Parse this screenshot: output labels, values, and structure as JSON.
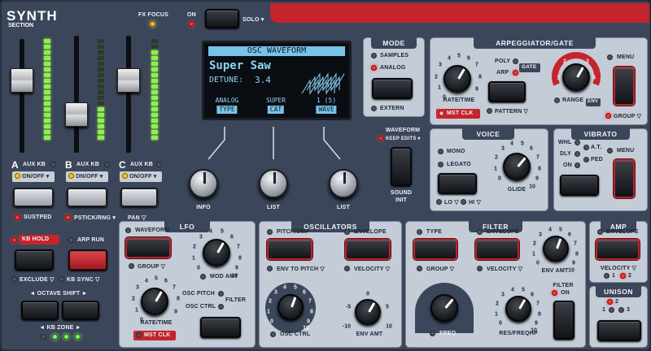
{
  "header": {
    "title": "SYNTH",
    "subtitle": "SECTION",
    "fx_focus": "FX FOCUS",
    "on": "ON",
    "solo": "SOLO ▾"
  },
  "lcd": {
    "title": "OSC WAVEFORM",
    "patch": "Super Saw",
    "param": "DETUNE:",
    "param_value": "3.4",
    "soft": [
      {
        "top": "ANALOG",
        "chip": "TYPE"
      },
      {
        "top": "SUPER",
        "chip": "CAT"
      },
      {
        "top": "1 (5)",
        "chip": "WAVE"
      }
    ]
  },
  "lcd_knobs": [
    "INFO",
    "LIST",
    "LIST"
  ],
  "mode": {
    "title": "MODE",
    "samples": "SAMPLES",
    "analog": "ANALOG",
    "extern": "EXTERN"
  },
  "waveform": {
    "label": "WAVEFORM",
    "keep": "KEEP EDITS ▾",
    "sound_init_1": "SOUND",
    "sound_init_2": "INIT"
  },
  "arp": {
    "title": "ARPEGGIATOR/GATE",
    "rate_time": "RATE/TIME",
    "mst_clk": "MST CLK",
    "poly": "POLY",
    "gate": "GATE",
    "arp": "ARP",
    "pattern": "PATTERN ▽",
    "range": "RANGE",
    "env": "ENV",
    "menu": "MENU",
    "group": "GROUP ▽",
    "rate_ticks": [
      "1",
      "2",
      "3",
      "4",
      "5",
      "6",
      "7",
      "8",
      "0",
      "9"
    ],
    "range_ticks": [
      "1",
      "2",
      "3",
      "4"
    ]
  },
  "voice": {
    "title": "VOICE",
    "mono": "MONO",
    "legato": "LEGATO",
    "glide": "GLIDE",
    "lo": "LO ▽",
    "hi": "HI ▽",
    "ticks": [
      "0",
      "1",
      "2",
      "3",
      "4",
      "5",
      "6",
      "7",
      "8",
      "9",
      "10"
    ]
  },
  "vibrato": {
    "title": "VIBRATO",
    "whl": "WHL",
    "at": "A.T.",
    "dly": "DLY",
    "ped": "PED",
    "on": "ON",
    "menu": "MENU"
  },
  "layers": [
    {
      "letter": "A",
      "aux": "AUX KB",
      "onoff": "ON/OFF ▾"
    },
    {
      "letter": "B",
      "aux": "AUX KB",
      "onoff": "ON/OFF ▾"
    },
    {
      "letter": "C",
      "aux": "AUX KB",
      "onoff": "ON/OFF ▾"
    }
  ],
  "layer_bottom": {
    "sustped": "SUSTPED",
    "pstick": "PSTICK/RNG ▾",
    "pan": "PAN ▽"
  },
  "kb": {
    "hold": "KB HOLD",
    "arp_run": "ARP RUN",
    "exclude": "EXCLUDE ▽",
    "kb_sync": "KB SYNC ▽",
    "octave_shift": "◄ OCTAVE SHIFT ►",
    "kb_zone": "◄ KB ZONE ►"
  },
  "lfo": {
    "title": "LFO",
    "waveform": "WAVEFORM",
    "group": "GROUP ▽",
    "mod_amt": "MOD AMT",
    "rate_time": "RATE/TIME",
    "mst_clk": "MST CLK",
    "osc_pitch": "OSC PITCH",
    "osc_ctrl": "OSC CTRL",
    "filter": "FILTER",
    "mod_ticks": [
      "0",
      "1",
      "2",
      "3",
      "4",
      "5",
      "6",
      "7",
      "8",
      "9",
      "10"
    ],
    "rate_ticks": [
      "1",
      "2",
      "3",
      "4",
      "5",
      "6",
      "7",
      "8",
      "0",
      "9"
    ]
  },
  "oscillators": {
    "title": "OSCILLATORS",
    "pitch_smp": "PITCH/SMP",
    "env_to_pitch": "ENV TO PITCH ▽",
    "envelope": "ENVELOPE",
    "velocity": "VELOCITY ▽",
    "osc_ctrl": "OSC CTRL",
    "env_amt": "ENV AMT",
    "osc_ticks": [
      "0",
      "1",
      "2",
      "3",
      "4",
      "5",
      "6",
      "7",
      "8",
      "9",
      "10"
    ],
    "env_ticks": [
      "-5",
      "0",
      "5",
      "-10",
      "10"
    ]
  },
  "filter": {
    "title": "FILTER",
    "type": "TYPE",
    "group": "GROUP ▽",
    "envelope": "ENVELOPE",
    "velocity": "VELOCITY ▽",
    "env_amt": "ENV AMT",
    "freq": "FREQ",
    "res_freqhp": "RES/FREQHP",
    "filter_on_1": "FILTER",
    "filter_on_2": "ON",
    "env_ticks": [
      "0",
      "1",
      "2",
      "3",
      "4",
      "5",
      "6",
      "7",
      "8",
      "9",
      "10"
    ],
    "res_ticks": [
      "0",
      "1",
      "2",
      "3",
      "4",
      "5",
      "6",
      "7",
      "8",
      "9",
      "10"
    ]
  },
  "amp": {
    "title": "AMP",
    "envelope": "ENVELOPE",
    "velocity": "VELOCITY ▽",
    "v1": "1",
    "v2": "2"
  },
  "unison": {
    "title": "UNISON",
    "n1": "1",
    "n2": "2",
    "n3": "3"
  }
}
